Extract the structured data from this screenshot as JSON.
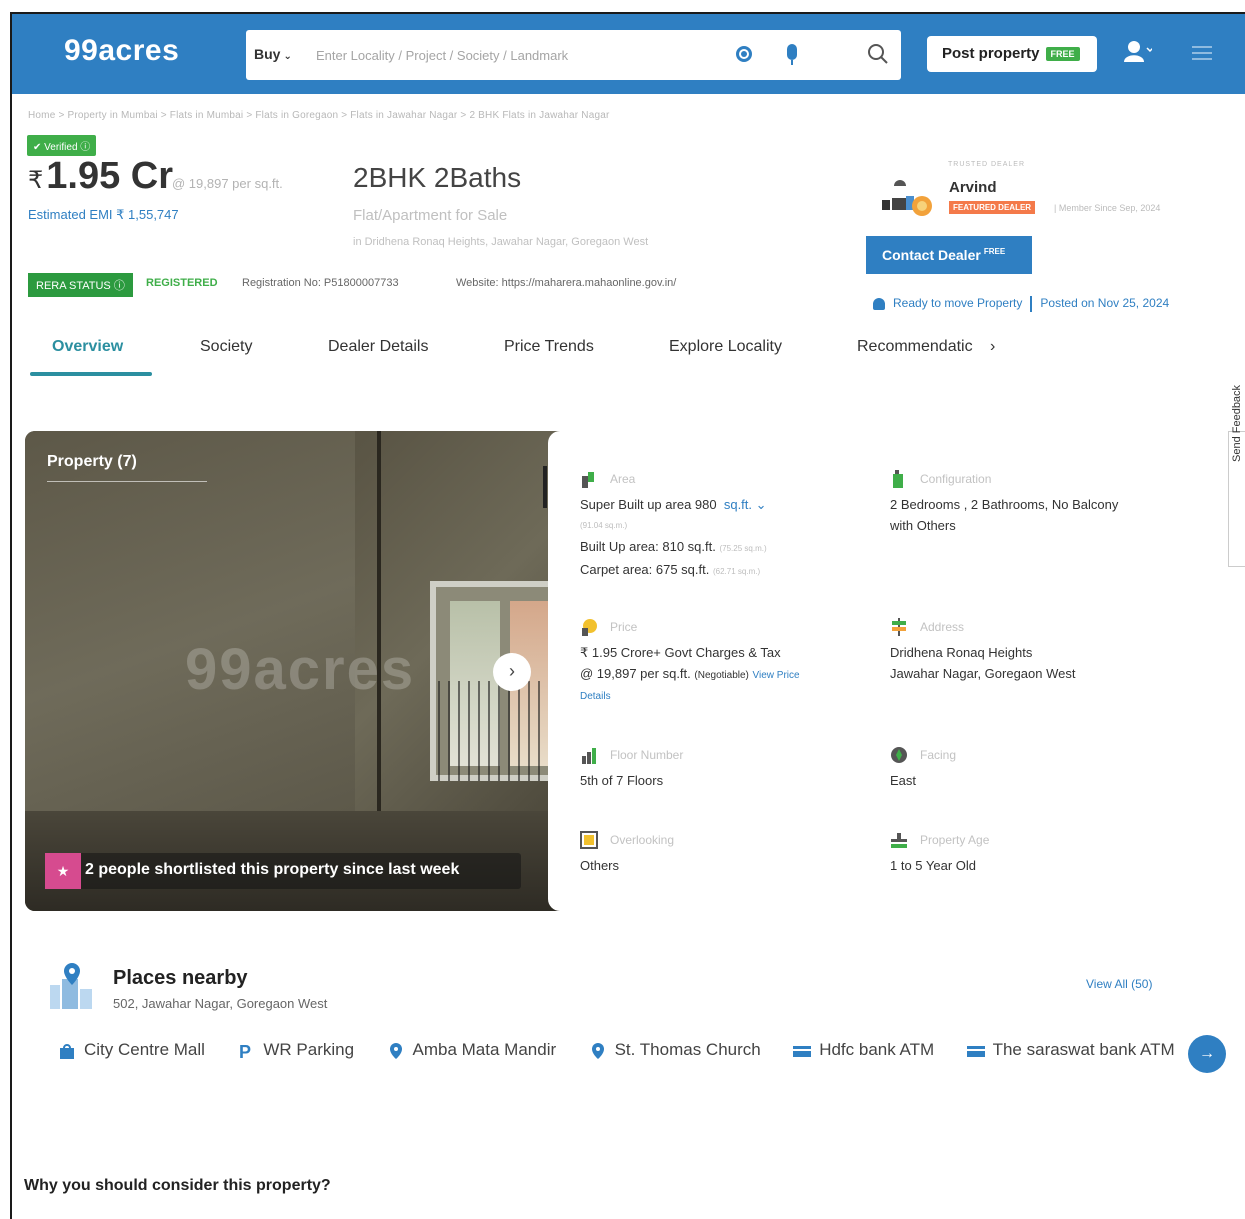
{
  "header": {
    "logo": "99acres",
    "buy_label": "Buy",
    "search_placeholder": "Enter Locality / Project / Society / Landmark",
    "post_property_label": "Post property",
    "post_property_tag": "FREE"
  },
  "breadcrumb": "Home > Property in Mumbai > Flats in Mumbai > Flats in Goregaon > Flats in Jawahar Nagar > 2 BHK Flats in Jawahar Nagar",
  "listing": {
    "verified_label": "Verified",
    "currency": "₹",
    "price": "1.95 Cr",
    "per_sqft": "@ 19,897 per sq.ft.",
    "emi": "Estimated EMI ₹ 1,55,747",
    "title": "2BHK 2Baths",
    "type": "Flat/Apartment for Sale",
    "location": "in Dridhena Ronaq Heights, Jawahar Nagar, Goregaon West"
  },
  "rera": {
    "badge": "RERA STATUS",
    "status": "REGISTERED",
    "registration": "Registration No: P51800007733",
    "website": "Website: https://maharera.mahaonline.gov.in/"
  },
  "dealer": {
    "label": "TRUSTED DEALER",
    "name": "Arvind",
    "badge": "FEATURED DEALER",
    "member_since": "| Member Since Sep, 2024",
    "contact_label": "Contact Dealer",
    "contact_tag": "FREE",
    "ready": "Ready to move Property",
    "posted": "Posted on Nov 25, 2024"
  },
  "tabs": [
    "Overview",
    "Society",
    "Dealer Details",
    "Price Trends",
    "Explore Locality",
    "Recommendatic"
  ],
  "gallery": {
    "title": "Property (7)",
    "watermark": "99acres",
    "shortlist": "2 people shortlisted this property since last week"
  },
  "details": {
    "area": {
      "label": "Area",
      "super": "Super Built up area 980",
      "unit": "sq.ft.",
      "super_sub": "(91.04 sq.m.)",
      "built": "Built Up area: 810 sq.ft.",
      "built_sub": "(75.25 sq.m.)",
      "carpet": "Carpet area: 675 sq.ft.",
      "carpet_sub": "(62.71 sq.m.)"
    },
    "configuration": {
      "label": "Configuration",
      "line1": "2 Bedrooms , 2 Bathrooms, No Balcony",
      "line2": "with Others"
    },
    "price": {
      "label": "Price",
      "line1": "₹ 1.95 Crore+ Govt Charges & Tax",
      "line2": "@ 19,897 per sq.ft.",
      "negotiable": "(Negotiable)",
      "link1": "View Price",
      "link2": "Details"
    },
    "address": {
      "label": "Address",
      "line1": "Dridhena Ronaq Heights",
      "line2": "Jawahar Nagar, Goregaon West"
    },
    "floor": {
      "label": "Floor Number",
      "value": "5th  of 7 Floors"
    },
    "facing": {
      "label": "Facing",
      "value": "East"
    },
    "overlooking": {
      "label": "Overlooking",
      "value": "Others"
    },
    "age": {
      "label": "Property Age",
      "value": "1 to 5 Year Old"
    }
  },
  "feedback": "Send Feedback",
  "places": {
    "title": "Places nearby",
    "subtitle": "502, Jawahar Nagar, Goregaon West",
    "view_all": "View All (50)",
    "chips": [
      {
        "label": "City Centre Mall",
        "icon": "shopping-bag-icon"
      },
      {
        "label": "WR Parking",
        "icon": "parking-icon"
      },
      {
        "label": "Amba Mata Mandir",
        "icon": "map-pin-icon"
      },
      {
        "label": "St. Thomas Church",
        "icon": "map-pin-icon"
      },
      {
        "label": "Hdfc bank ATM",
        "icon": "atm-card-icon"
      },
      {
        "label": "The saraswat bank ATM",
        "icon": "atm-card-icon"
      }
    ]
  },
  "why": "Why you should consider this property?",
  "colors": {
    "brand_blue": "#2f7fc2",
    "green": "#3fae49",
    "teal": "#2b8fa0",
    "featured_orange": "#f47a4a"
  }
}
